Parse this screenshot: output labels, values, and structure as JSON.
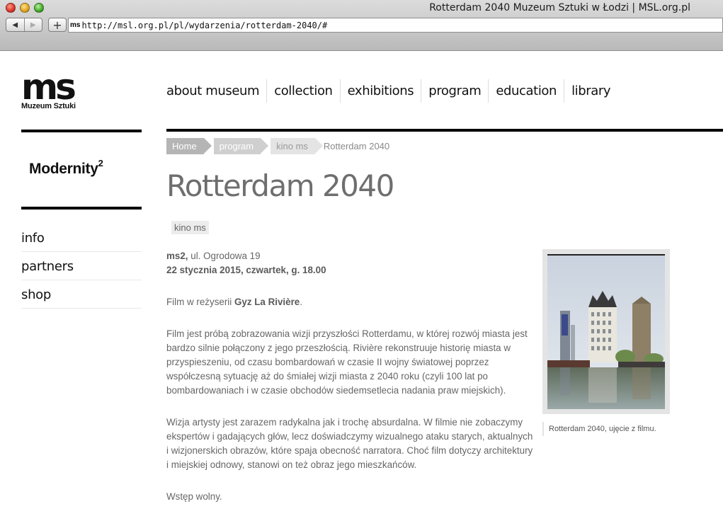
{
  "browser": {
    "window_title": "Rotterdam 2040 Muzeum Sztuki w Łodzi | MSL.org.pl",
    "back_icon": "◀",
    "forward_icon": "▶",
    "add_icon": "+",
    "favicon": "ms",
    "url": "http://msl.org.pl/pl/wydarzenia/rotterdam-2040/#"
  },
  "logo": {
    "mark": "ms",
    "name": "Muzeum Sztuki"
  },
  "nav": {
    "items": [
      {
        "label": "about museum"
      },
      {
        "label": "collection"
      },
      {
        "label": "exhibitions"
      },
      {
        "label": "program"
      },
      {
        "label": "education"
      },
      {
        "label": "library"
      }
    ]
  },
  "sidebar": {
    "modernity": "Modernity",
    "modernity_sup": "2",
    "items": [
      {
        "label": "info"
      },
      {
        "label": "partners"
      },
      {
        "label": "shop"
      }
    ]
  },
  "breadcrumb": {
    "home": "Home",
    "program": "program",
    "kino": "kino ms",
    "current": "Rotterdam 2040"
  },
  "page": {
    "title": "Rotterdam 2040",
    "tag": "kino ms",
    "venue_bold": "ms2,",
    "venue_address": " ul. Ogrodowa 19",
    "date": "22 stycznia 2015, czwartek, g. 18.00",
    "director_prefix": "Film w reżyserii ",
    "director_name": "Gyz La Rivière",
    "director_suffix": ".",
    "paragraph1": "Film jest próbą zobrazowania wizji przyszłości Rotterdamu, w której rozwój miasta jest bardzo silnie połączony z jego przeszłością. Rivière rekonstruuje historię miasta w przyspieszeniu, od czasu bombardowań w czasie II wojny światowej poprzez współczesną sytuację aż do śmiałej wizji miasta z 2040 roku (czyli 100 lat po bombardowaniach i w czasie obchodów siedemsetlecia nadania praw miejskich).",
    "paragraph2": "Wizja artysty jest zarazem radykalna jak i trochę absurdalna. W filmie nie zobaczymy ekspertów i gadających głów, lecz doświadczymy wizualnego ataku starych, aktualnych i wizjonerskich obrazów, które spaja obecność narratora. Choć film dotyczy architektury i miejskiej odnowy, stanowi on też obraz jego mieszkańców.",
    "admission": "Wstęp wolny.",
    "image_caption": "Rotterdam 2040, ujęcie z filmu."
  },
  "colors": {
    "title_gray": "#6e6e6e",
    "rule_black": "#000000",
    "crumb_home": "#b5b5b5",
    "crumb": "#cfcfcf"
  }
}
